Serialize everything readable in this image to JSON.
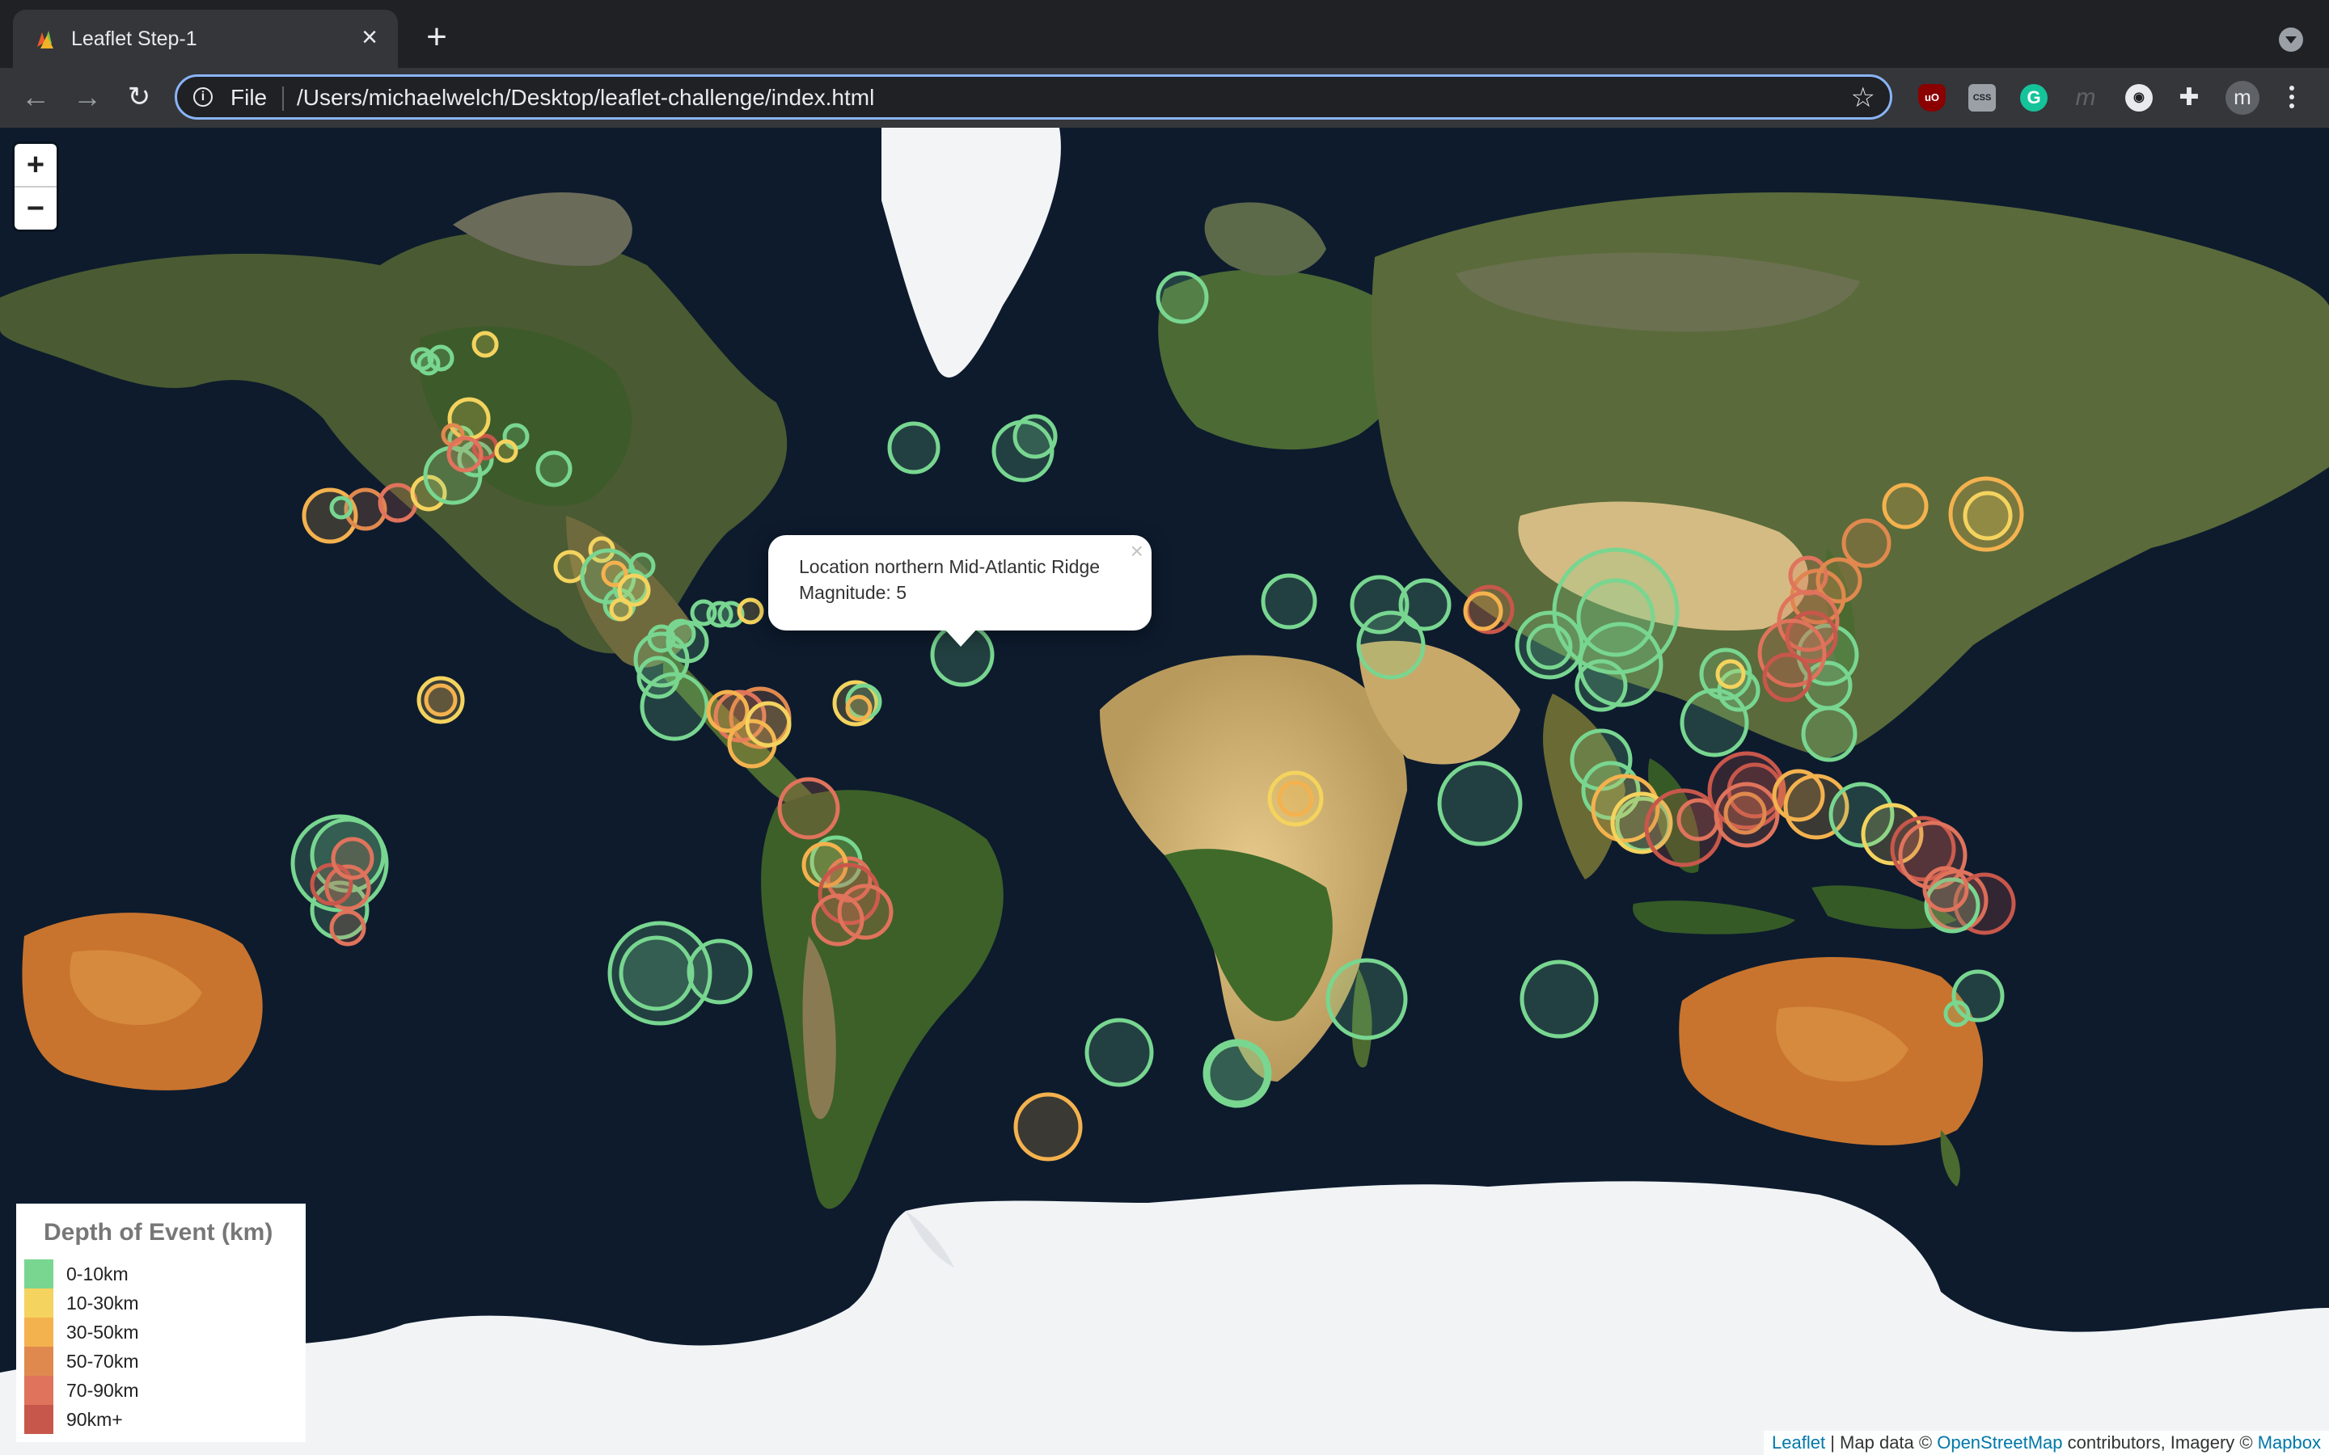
{
  "browser": {
    "tab_title": "Leaflet Step-1",
    "close_tab": "×",
    "new_tab": "+",
    "scheme_label": "File",
    "url": "/Users/michaelwelch/Desktop/leaflet-challenge/index.html",
    "avatar_initial": "m",
    "extensions": [
      "ublock-origin-icon",
      "css-viewer-icon",
      "grammarly-icon",
      "extension-m-icon",
      "extension-circle-icon",
      "extensions-puzzle-icon"
    ]
  },
  "map": {
    "zoom_in": "+",
    "zoom_out": "−",
    "popup": {
      "location_line": "Location northern Mid-Atlantic Ridge",
      "magnitude_line": "Magnitude: 5",
      "close": "×"
    },
    "legend": {
      "title": "Depth of Event (km)",
      "items": [
        {
          "label": "0-10km",
          "color": "#78d690"
        },
        {
          "label": "10-30km",
          "color": "#f4d35e"
        },
        {
          "label": "30-50km",
          "color": "#f4b24e"
        },
        {
          "label": "50-70km",
          "color": "#e0894e"
        },
        {
          "label": "70-90km",
          "color": "#e0735c"
        },
        {
          "label": "90km+",
          "color": "#c8574b"
        }
      ]
    },
    "attribution": {
      "leaflet": "Leaflet",
      "sep": " | Map data © ",
      "osm": "OpenStreetMap",
      "mid": " contributors, Imagery © ",
      "mapbox": "Mapbox"
    }
  }
}
